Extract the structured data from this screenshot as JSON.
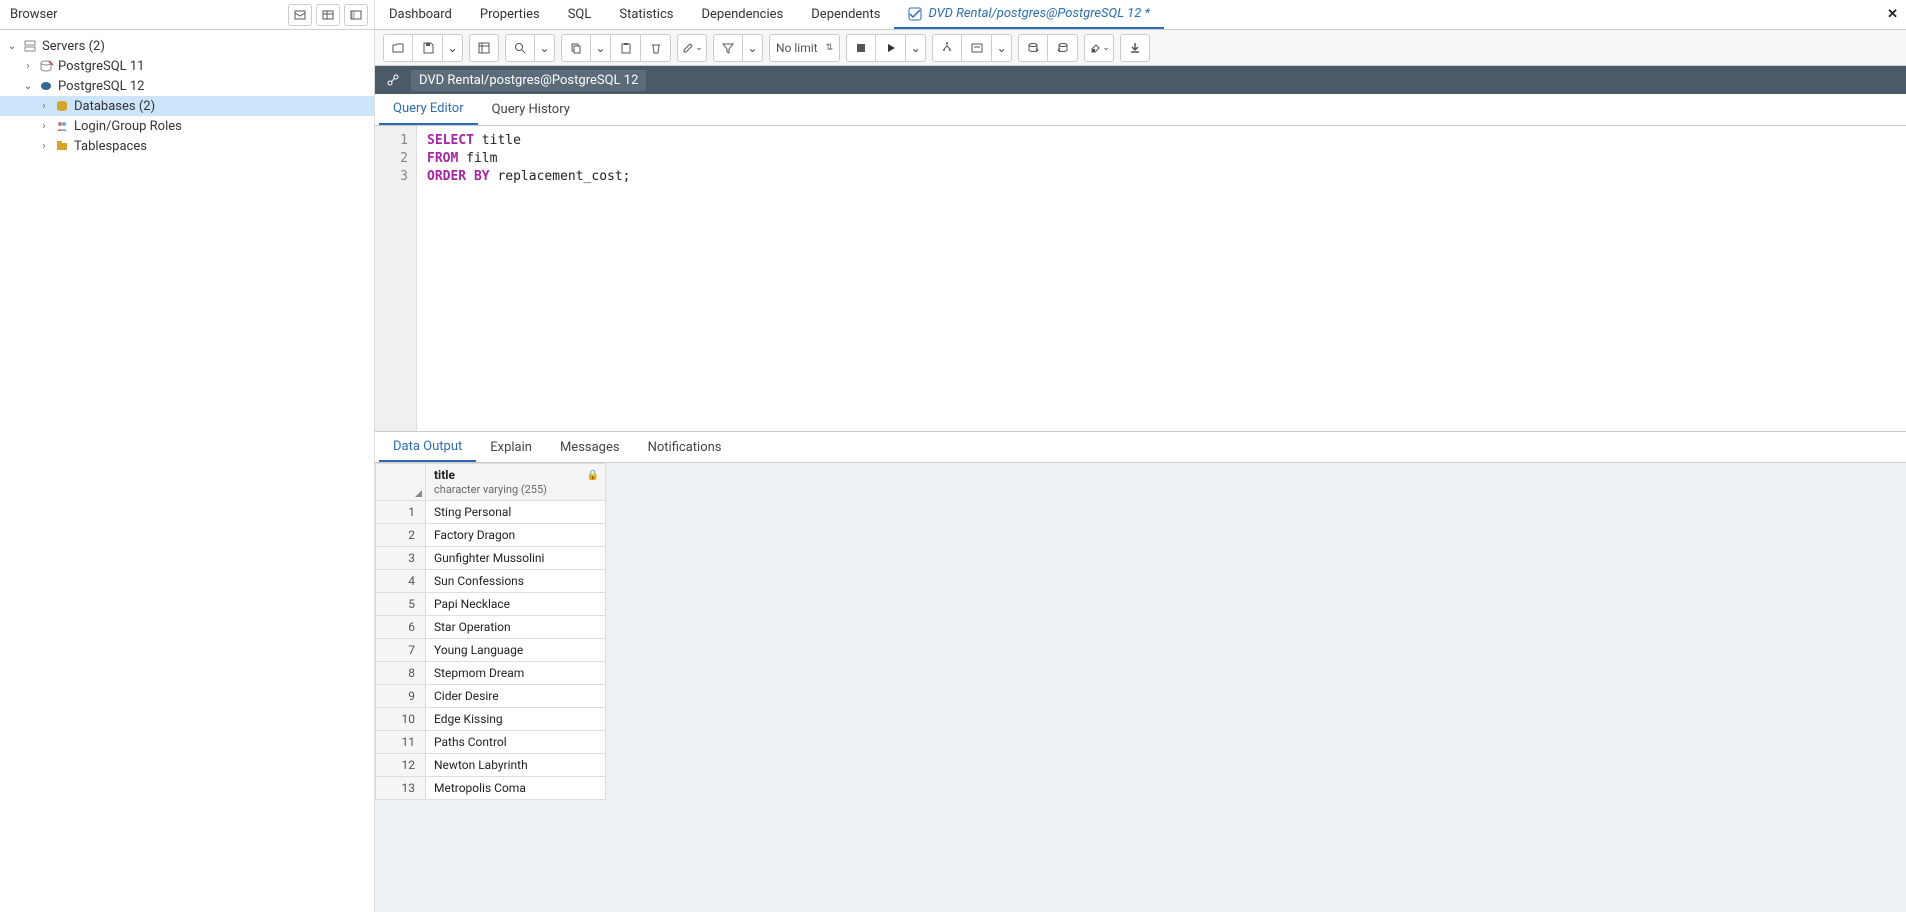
{
  "browser": {
    "title": "Browser"
  },
  "tabs": {
    "items": [
      "Dashboard",
      "Properties",
      "SQL",
      "Statistics",
      "Dependencies",
      "Dependents"
    ],
    "active_label": "DVD Rental/postgres@PostgreSQL 12 *"
  },
  "tree": {
    "servers": "Servers (2)",
    "pg11": "PostgreSQL 11",
    "pg12": "PostgreSQL 12",
    "databases": "Databases (2)",
    "roles": "Login/Group Roles",
    "tablespaces": "Tablespaces"
  },
  "toolbar": {
    "limit_label": "No limit"
  },
  "connection": {
    "text": "DVD Rental/postgres@PostgreSQL 12"
  },
  "editor_tabs": {
    "query": "Query Editor",
    "history": "Query History"
  },
  "query": {
    "line1_kw": "SELECT",
    "line1_rest": " title",
    "line2_kw": "FROM",
    "line2_rest": " film",
    "line3_kw1": "ORDER",
    "line3_kw2": "BY",
    "line3_rest": " replacement_cost;"
  },
  "result_tabs": {
    "data": "Data Output",
    "explain": "Explain",
    "messages": "Messages",
    "notifications": "Notifications"
  },
  "result": {
    "col_name": "title",
    "col_type": "character varying (255)",
    "rows": [
      "Sting Personal",
      "Factory Dragon",
      "Gunfighter Mussolini",
      "Sun Confessions",
      "Papi Necklace",
      "Star Operation",
      "Young Language",
      "Stepmom Dream",
      "Cider Desire",
      "Edge Kissing",
      "Paths Control",
      "Newton Labyrinth",
      "Metropolis Coma"
    ]
  }
}
